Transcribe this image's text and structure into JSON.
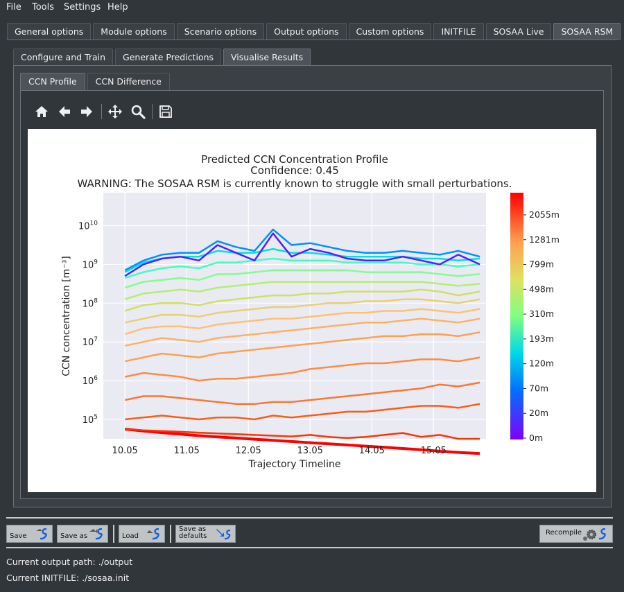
{
  "menu": [
    "File",
    "Tools",
    "Settings",
    "Help"
  ],
  "main_tabs": [
    "General options",
    "Module options",
    "Scenario options",
    "Output options",
    "Custom options",
    "INITFILE",
    "SOSAA Live",
    "SOSAA RSM"
  ],
  "main_tab_active": 7,
  "rsm_tabs": [
    "Configure and Train",
    "Generate Predictions",
    "Visualise Results"
  ],
  "rsm_tab_active": 2,
  "vis_tabs": [
    "CCN Profile",
    "CCN Difference"
  ],
  "vis_tab_active": 0,
  "toolbar": [
    "home-icon",
    "back-icon",
    "forward-icon",
    "pan-icon",
    "zoom-icon",
    "save-figure-icon"
  ],
  "buttons": {
    "save": "Save",
    "save_as": "Save as",
    "load": "Load",
    "save_defaults_1": "Save as",
    "save_defaults_2": "defaults",
    "recompile": "Recompile"
  },
  "status": {
    "output_path": "Current output path: ./output",
    "initfile": "Current INITFILE: ./sosaa.init"
  },
  "chart_data": {
    "type": "line",
    "title": "Predicted CCN Concentration Profile",
    "subtitle": "Confidence: 0.45",
    "warning": "WARNING: The SOSAA RSM is currently known to struggle with small perturbations.",
    "xlabel": "Trajectory Timeline",
    "ylabel": "CCN concentration [m⁻³]",
    "yscale": "log",
    "xlim": [
      9.7,
      15.9
    ],
    "ylim_log10": [
      4.5,
      10.85
    ],
    "xticks": [
      "10.05",
      "11.05",
      "12.05",
      "13.05",
      "14.05",
      "15.05"
    ],
    "xtick_values": [
      10.05,
      11.05,
      12.05,
      13.05,
      14.05,
      15.05
    ],
    "yticks": [
      {
        "base": "10",
        "exp": "5",
        "v": 5
      },
      {
        "base": "10",
        "exp": "6",
        "v": 6
      },
      {
        "base": "10",
        "exp": "7",
        "v": 7
      },
      {
        "base": "10",
        "exp": "8",
        "v": 8
      },
      {
        "base": "10",
        "exp": "9",
        "v": 9
      },
      {
        "base": "10",
        "exp": "10",
        "v": 10
      }
    ],
    "grid": true,
    "x": [
      10.05,
      10.35,
      10.65,
      10.95,
      11.25,
      11.55,
      11.85,
      12.15,
      12.45,
      12.75,
      13.05,
      13.35,
      13.65,
      13.95,
      14.25,
      14.55,
      14.85,
      15.15,
      15.45,
      15.8
    ],
    "series": [
      {
        "name": "0m",
        "color": "#ff0000",
        "values": [
          4.75,
          4.7,
          4.66,
          4.62,
          4.58,
          4.55,
          4.52,
          4.49,
          4.46,
          4.43,
          4.4,
          4.37,
          4.34,
          4.31,
          4.28,
          4.25,
          4.22,
          4.18,
          4.15,
          4.12
        ]
      },
      {
        "name": "20m",
        "color": "#ff3300",
        "values": [
          4.75,
          4.72,
          4.7,
          4.68,
          4.66,
          4.64,
          4.62,
          4.6,
          4.58,
          4.56,
          4.6,
          4.55,
          4.52,
          4.55,
          4.6,
          4.65,
          4.55,
          4.6,
          4.5,
          4.5
        ]
      },
      {
        "name": "70m",
        "color": "#ff5a10",
        "values": [
          5.0,
          5.05,
          5.1,
          5.05,
          5.0,
          5.05,
          5.05,
          5.0,
          5.1,
          5.05,
          5.1,
          5.15,
          5.2,
          5.2,
          5.25,
          5.3,
          5.35,
          5.35,
          5.3,
          5.4
        ]
      },
      {
        "name": "120m",
        "color": "#ff7430",
        "values": [
          5.5,
          5.6,
          5.6,
          5.55,
          5.5,
          5.45,
          5.4,
          5.4,
          5.45,
          5.45,
          5.5,
          5.55,
          5.6,
          5.65,
          5.7,
          5.75,
          5.8,
          5.9,
          5.85,
          5.95
        ]
      },
      {
        "name": "193m",
        "color": "#ff8a40",
        "values": [
          6.1,
          6.2,
          6.15,
          6.1,
          6.0,
          6.05,
          6.05,
          6.1,
          6.15,
          6.2,
          6.3,
          6.35,
          6.4,
          6.45,
          6.45,
          6.5,
          6.55,
          6.55,
          6.5,
          6.6
        ]
      },
      {
        "name": "310m",
        "color": "#ff9f50",
        "values": [
          6.5,
          6.6,
          6.7,
          6.65,
          6.6,
          6.7,
          6.75,
          6.8,
          6.85,
          6.9,
          6.95,
          7.0,
          7.05,
          7.1,
          7.15,
          7.15,
          7.2,
          7.2,
          7.15,
          7.25
        ]
      },
      {
        "name": "498m",
        "color": "#ffb060",
        "values": [
          6.9,
          7.0,
          7.1,
          7.05,
          7.0,
          7.1,
          7.15,
          7.2,
          7.25,
          7.3,
          7.35,
          7.4,
          7.45,
          7.5,
          7.5,
          7.55,
          7.6,
          7.55,
          7.5,
          7.6
        ]
      },
      {
        "name": "799m",
        "color": "#ffc070",
        "values": [
          7.2,
          7.35,
          7.4,
          7.4,
          7.35,
          7.45,
          7.5,
          7.55,
          7.6,
          7.6,
          7.65,
          7.7,
          7.75,
          7.75,
          7.8,
          7.8,
          7.85,
          7.8,
          7.75,
          7.85
        ]
      },
      {
        "name": "1281m",
        "color": "#e8d070",
        "values": [
          7.5,
          7.6,
          7.7,
          7.7,
          7.65,
          7.75,
          7.8,
          7.85,
          7.9,
          7.9,
          7.95,
          8.0,
          8.0,
          8.05,
          8.05,
          8.1,
          8.1,
          8.05,
          8.0,
          8.1
        ]
      },
      {
        "name": "2055m",
        "color": "#d0e060",
        "values": [
          7.8,
          7.95,
          8.0,
          8.0,
          7.95,
          8.05,
          8.1,
          8.15,
          8.2,
          8.2,
          8.25,
          8.25,
          8.3,
          8.3,
          8.3,
          8.3,
          8.35,
          8.3,
          8.2,
          8.3
        ]
      },
      {
        "name": "",
        "color": "#b0f070",
        "values": [
          8.1,
          8.25,
          8.3,
          8.35,
          8.3,
          8.4,
          8.45,
          8.5,
          8.55,
          8.55,
          8.55,
          8.55,
          8.55,
          8.55,
          8.55,
          8.55,
          8.55,
          8.5,
          8.45,
          8.5
        ]
      },
      {
        "name": "",
        "color": "#80ff90",
        "values": [
          8.4,
          8.55,
          8.6,
          8.65,
          8.6,
          8.75,
          8.75,
          8.8,
          8.85,
          8.85,
          8.85,
          8.85,
          8.85,
          8.8,
          8.8,
          8.8,
          8.8,
          8.75,
          8.7,
          8.75
        ]
      },
      {
        "name": "",
        "color": "#40ffc0",
        "values": [
          8.65,
          8.8,
          8.9,
          8.95,
          8.9,
          9.05,
          9.05,
          9.1,
          9.15,
          9.1,
          9.1,
          9.1,
          9.05,
          9.05,
          9.05,
          9.05,
          9.0,
          9.0,
          8.95,
          9.0
        ]
      },
      {
        "name": "",
        "color": "#00e0e8",
        "values": [
          8.8,
          9.05,
          9.15,
          9.2,
          9.2,
          9.35,
          9.3,
          9.3,
          9.4,
          9.3,
          9.3,
          9.25,
          9.2,
          9.2,
          9.2,
          9.2,
          9.15,
          9.15,
          9.1,
          9.15
        ]
      },
      {
        "name": "",
        "color": "#0090ff",
        "values": [
          8.85,
          9.1,
          9.25,
          9.3,
          9.3,
          9.6,
          9.45,
          9.35,
          9.9,
          9.5,
          9.55,
          9.45,
          9.35,
          9.3,
          9.3,
          9.35,
          9.3,
          9.25,
          9.35,
          9.2
        ]
      },
      {
        "name": "",
        "color": "#5020ff",
        "values": [
          8.7,
          9.0,
          9.15,
          9.2,
          9.1,
          9.5,
          9.3,
          9.1,
          9.8,
          9.2,
          9.4,
          9.3,
          9.15,
          9.1,
          9.1,
          9.2,
          9.1,
          9.0,
          9.25,
          9.0
        ]
      }
    ],
    "colorbar": {
      "labels": [
        "0m",
        "20m",
        "70m",
        "120m",
        "193m",
        "310m",
        "498m",
        "799m",
        "1281m",
        "2055m"
      ]
    }
  }
}
